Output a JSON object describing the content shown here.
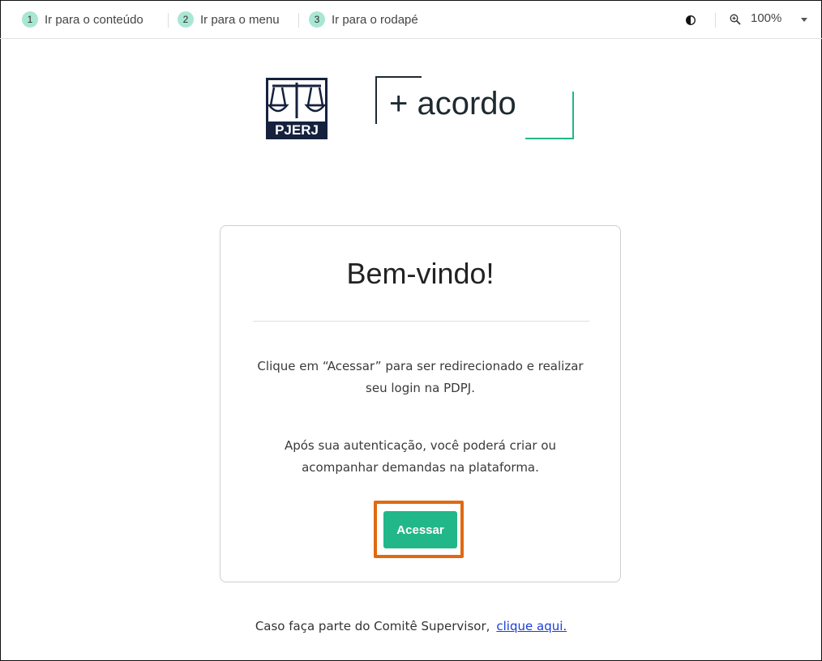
{
  "skip_links": [
    {
      "number": "1",
      "label": "Ir para o conteúdo"
    },
    {
      "number": "2",
      "label": "Ir para o menu"
    },
    {
      "number": "3",
      "label": "Ir para o rodapé"
    }
  ],
  "accessibility": {
    "contrast_icon": "contrast-icon",
    "zoom_icon": "zoom-in-icon",
    "zoom_value": "100%"
  },
  "logos": {
    "pjerj_text": "PJERJ",
    "acordo_text": "+acordo"
  },
  "card": {
    "title": "Bem-vindo!",
    "paragraph1": "Clique em “Acessar” para ser redirecionado e realizar seu login na PDPJ.",
    "paragraph2": "Após sua autenticação, você poderá criar ou acompanhar demandas na plataforma.",
    "button_label": "Acessar"
  },
  "footer": {
    "text": "Caso faça parte do Comitê Supervisor,",
    "link_label": "clique aqui."
  },
  "colors": {
    "accent": "#22b788",
    "highlight": "#e06a10",
    "link": "#1a3ed6",
    "badge": "#a9e6d3"
  }
}
